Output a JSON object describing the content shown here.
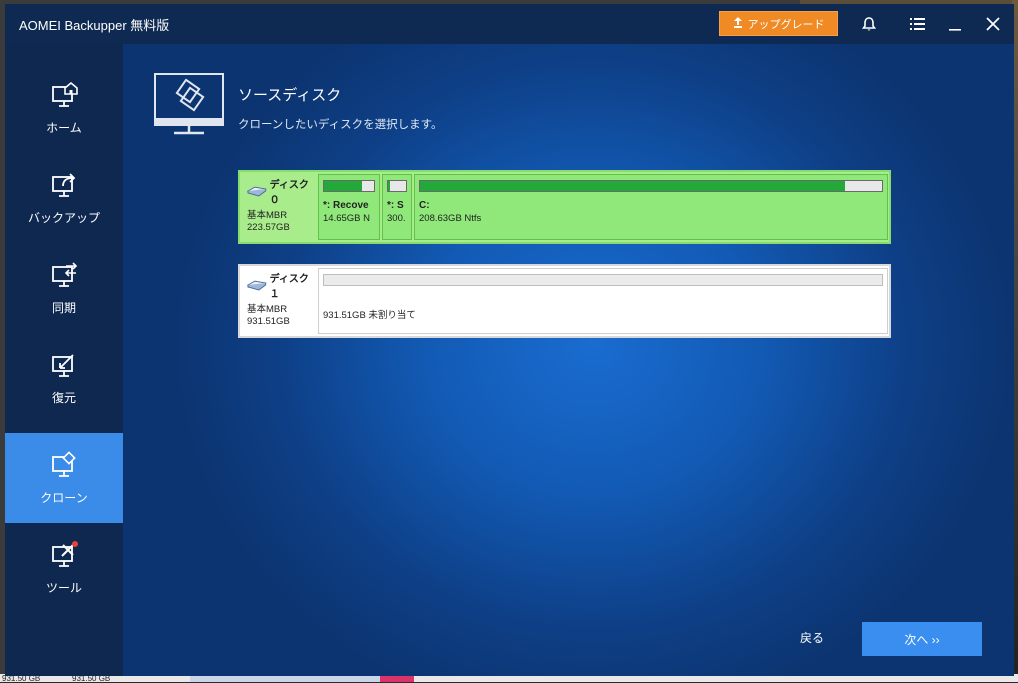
{
  "window": {
    "title": "AOMEI Backupper 無料版",
    "upgrade_label": "アップグレード",
    "icons": [
      "bell-icon",
      "menu-icon",
      "minimize-icon",
      "close-icon"
    ]
  },
  "sidebar": {
    "items": [
      {
        "label": "ホーム",
        "icon": "home-icon",
        "active": false
      },
      {
        "label": "バックアップ",
        "icon": "backup-icon",
        "active": false
      },
      {
        "label": "同期",
        "icon": "sync-icon",
        "active": false
      },
      {
        "label": "復元",
        "icon": "restore-icon",
        "active": false
      },
      {
        "label": "クローン",
        "icon": "clone-icon",
        "active": true
      },
      {
        "label": "ツール",
        "icon": "tools-icon",
        "active": false
      }
    ]
  },
  "main": {
    "title": "ソースディスク",
    "subtitle": "クローンしたいディスクを選択します。",
    "disks": [
      {
        "name": "ディスク０",
        "type": "基本MBR",
        "size": "223.57GB",
        "selected": true,
        "partitions": [
          {
            "label": "*: Recove",
            "size": "14.65GB N",
            "used_fraction": 0.75
          },
          {
            "label": "*: S",
            "size": "300.",
            "used_fraction": 0.1
          },
          {
            "label": "C:",
            "size": "208.63GB Ntfs",
            "used_fraction": 0.92
          }
        ]
      },
      {
        "name": "ディスク１",
        "type": "基本MBR",
        "size": "931.51GB",
        "selected": false,
        "partitions": [
          {
            "label": "",
            "size": "931.51GB 未割り当て",
            "used_fraction": 0
          }
        ]
      }
    ],
    "back_label": "戻る",
    "next_label": "次へ ››"
  },
  "desktop": {
    "bottom_texts": [
      "931.50 GB",
      "931.50 GB"
    ]
  },
  "colors": {
    "accent": "#3a8ce8",
    "upgrade": "#f08a24",
    "selected_disk": "#a8ec8c",
    "used_bar": "#22a93a"
  }
}
